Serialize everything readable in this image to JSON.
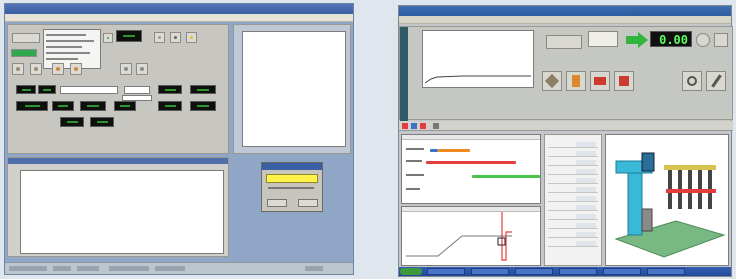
{
  "left_app": {
    "popup_message": "",
    "colors": {
      "window_bg": "#8fa6c6",
      "panel": "#c8c6c0",
      "lcd_bg": "#0d100d",
      "lcd_digit": "#3ac23a",
      "popup_highlight": "#fff34a",
      "title_bar": "#3a5ea2"
    }
  },
  "right_app": {
    "readout_value": "0.00",
    "colors": {
      "title_bar": "#2d5aa0",
      "readout_bg": "#101010",
      "readout_digit": "#5cff5c",
      "arrow": "#31b43b",
      "bar_orange": "#f08a1f",
      "bar_red": "#e33d3d",
      "bar_green": "#45c34a",
      "curve_line": "#e33d3d",
      "model_cyan": "#39b8d8",
      "model_green": "#78b882"
    },
    "icons": [
      "tool-icon",
      "save-icon",
      "printer-icon",
      "help-icon",
      "gear-icon",
      "wrench-icon",
      "arrow-right-icon"
    ]
  }
}
